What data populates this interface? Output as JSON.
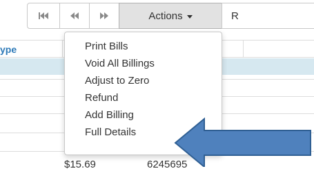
{
  "toolbar": {
    "first_icon": "first-page-icon",
    "prev_icon": "previous-page-icon",
    "next_icon": "next-page-icon",
    "actions_label": "Actions",
    "partial_button_label": "R"
  },
  "grid": {
    "column_header_partial": "ype",
    "visible_row": {
      "amount": "$15.69",
      "number": "6245695"
    }
  },
  "actions_menu": {
    "items": [
      {
        "label": "Print Bills"
      },
      {
        "label": "Void All Billings"
      },
      {
        "label": "Adjust to Zero"
      },
      {
        "label": "Refund"
      },
      {
        "label": "Add Billing"
      },
      {
        "label": "Full Details"
      }
    ]
  },
  "annotation": {
    "arrow_color": "#4f81bd",
    "arrow_icon": "left-pointing-arrow-icon"
  },
  "colors": {
    "header_text": "#2e7ab8",
    "highlight_row": "#d6e8f0",
    "actions_button_bg": "#e2e2e2"
  }
}
